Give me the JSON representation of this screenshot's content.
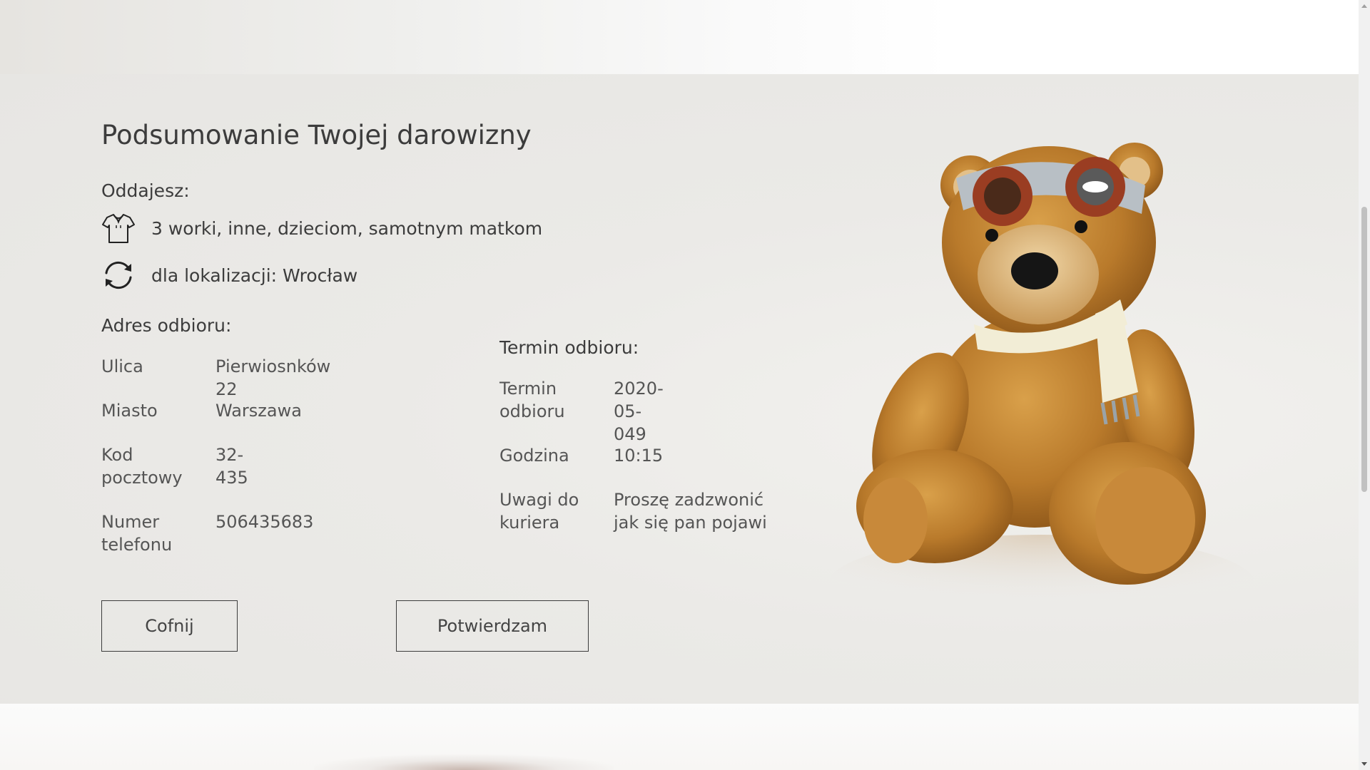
{
  "summary": {
    "title": "Podsumowanie Twojej darowizny",
    "giving_label": "Oddajesz:",
    "items_text": "3 worki, inne, dzieciom, samotnym matkom",
    "location_text": "dla lokalizacji: Wrocław"
  },
  "address": {
    "heading": "Adres odbioru:",
    "street_label": "Ulica",
    "street_value": "Pierwiosnków 22",
    "city_label": "Miasto",
    "city_value": "Warszawa",
    "postal_label": "Kod pocztowy",
    "postal_value": "32-435",
    "phone_label": "Numer telefonu",
    "phone_value": "506435683"
  },
  "pickup": {
    "heading": "Termin odbioru:",
    "date_label": "Termin odbioru",
    "date_value": "2020-05-049",
    "time_label": "Godzina",
    "time_value": "10:15",
    "notes_label": "Uwagi do kuriera",
    "notes_value": "Proszę zadzwonić jak się pan pojawi"
  },
  "buttons": {
    "back_label": "Cofnij",
    "confirm_label": "Potwierdzam"
  },
  "icons": {
    "items": "shirt-icon",
    "location": "refresh-icon"
  }
}
